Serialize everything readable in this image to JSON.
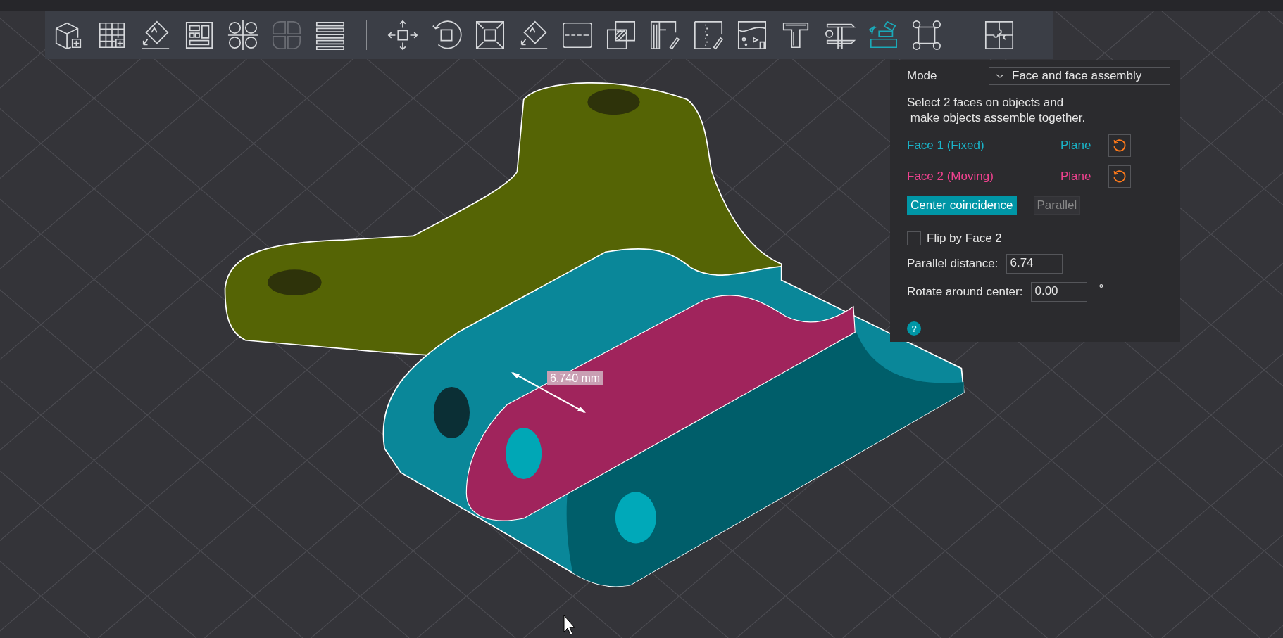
{
  "toolbar": {
    "groups": [
      [
        {
          "kind": "cube-add",
          "selected": false,
          "disabled": false
        },
        {
          "kind": "grid-add",
          "selected": false,
          "disabled": false
        },
        {
          "kind": "diamond-arrow",
          "selected": false,
          "disabled": false
        },
        {
          "kind": "layout-blocks",
          "selected": false,
          "disabled": false
        },
        {
          "kind": "circles",
          "selected": false,
          "disabled": false
        },
        {
          "kind": "quarter-circles",
          "selected": false,
          "disabled": true
        },
        {
          "kind": "stacked-bars",
          "selected": false,
          "disabled": false
        }
      ],
      [
        {
          "kind": "move-arrows",
          "selected": false,
          "disabled": false
        },
        {
          "kind": "rotate-arrow",
          "selected": false,
          "disabled": false
        },
        {
          "kind": "scale-frame",
          "selected": false,
          "disabled": false
        },
        {
          "kind": "diamond-arrow",
          "selected": false,
          "disabled": false
        },
        {
          "kind": "dashed-rectangle",
          "selected": false,
          "disabled": false
        },
        {
          "kind": "overlap-squares",
          "selected": false,
          "disabled": false
        },
        {
          "kind": "brush-bars",
          "selected": false,
          "disabled": false
        },
        {
          "kind": "brush-dotted",
          "selected": false,
          "disabled": false
        },
        {
          "kind": "spray-wave",
          "selected": false,
          "disabled": false
        },
        {
          "kind": "t-shape",
          "selected": false,
          "disabled": false
        },
        {
          "kind": "caliper",
          "selected": false,
          "disabled": false
        },
        {
          "kind": "tilted-blocks",
          "selected": true,
          "disabled": false
        },
        {
          "kind": "rounded-corners-square",
          "selected": false,
          "disabled": false
        }
      ],
      [
        {
          "kind": "puzzle",
          "selected": false,
          "disabled": false
        }
      ]
    ]
  },
  "panel": {
    "mode_label": "Mode",
    "mode_value": "Face and face assembly",
    "instruction_lines": [
      "Select 2 faces on objects and",
      " make objects assemble together."
    ],
    "faces": [
      {
        "label": "Face 1 (Fixed)",
        "type": "Plane",
        "color": "#1ab4c8"
      },
      {
        "label": "Face 2 (Moving)",
        "type": "Plane",
        "color": "#f0428f"
      }
    ],
    "align_buttons": [
      {
        "label": "Center coincidence",
        "selected": true
      },
      {
        "label": "Parallel",
        "selected": false
      }
    ],
    "flip": {
      "label": "Flip by Face 2",
      "checked": false
    },
    "parallel_distance": {
      "label": "Parallel distance:",
      "value": "6.74"
    },
    "rotate": {
      "label": "Rotate around center:",
      "value": "0.00",
      "unit": "°"
    },
    "help": "?"
  },
  "viewport": {
    "dimension_label": "6.740 mm"
  }
}
